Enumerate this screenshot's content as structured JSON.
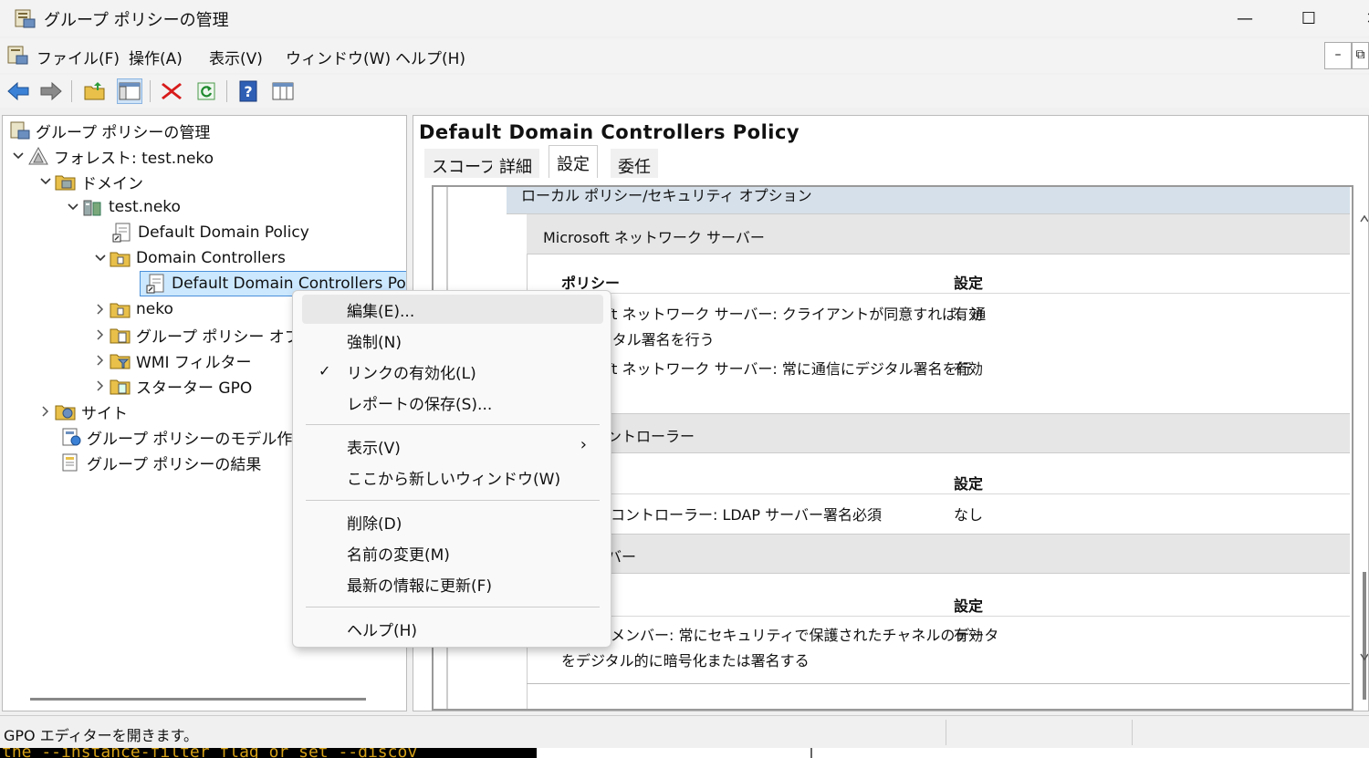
{
  "window": {
    "title": "グループ ポリシーの管理",
    "controls": {
      "minimize": "—",
      "maximize": "☐",
      "close": "✕"
    }
  },
  "menubar": {
    "items": [
      "ファイル(F)",
      "操作(A)",
      "表示(V)",
      "ウィンドウ(W)",
      "ヘルプ(H)"
    ],
    "mdi_min": "–",
    "mdi_restore": "⧉"
  },
  "toolbar": {
    "icons": [
      "back-arrow-icon",
      "forward-arrow-icon",
      "up-folder-icon",
      "show-hide-tree-icon",
      "delete-icon",
      "refresh-icon",
      "help-icon",
      "properties-icon"
    ]
  },
  "tree": {
    "root": "グループ ポリシーの管理",
    "forest": "フォレスト: test.neko",
    "domains": "ドメイン",
    "domain": "test.neko",
    "default_domain_policy": "Default Domain Policy",
    "domain_controllers": "Domain Controllers",
    "dc_policy": "Default Domain Controllers Pol",
    "neko": "neko",
    "gpo_objects": "グループ ポリシー オブジ",
    "wmi_filters": "WMI フィルター",
    "starter_gpo": "スターター GPO",
    "sites": "サイト",
    "modeling": "グループ ポリシーのモデル作成",
    "results": "グループ ポリシーの結果"
  },
  "right_pane": {
    "title": "Default Domain Controllers Policy",
    "tabs": [
      "スコープ",
      "詳細",
      "設定",
      "委任"
    ],
    "active_tab": "設定",
    "report": {
      "top_header": "ローカル ポリシー/セキュリティ オプション",
      "section1": {
        "title": "Microsoft ネットワーク サーバー",
        "col_policy": "ポリシー",
        "col_setting": "設定",
        "rows": [
          {
            "policy_l1": "oft ネットワーク サーバー: クライアントが同意すれば、通",
            "policy_l2": "ジタル署名を行う",
            "setting": "有効"
          },
          {
            "policy_l1": "oft ネットワーク サーバー: 常に通信にデジタル署名を行",
            "setting": "有効"
          }
        ]
      },
      "section2": {
        "title": "ントローラー",
        "col_setting": "設定",
        "rows": [
          {
            "policy": "コントローラー: LDAP サーバー署名必須",
            "setting": "なし"
          }
        ]
      },
      "section3": {
        "title": "バー",
        "col_setting": "設定",
        "rows": [
          {
            "policy_l1": "メンバー: 常にセキュリティで保護されたチャネルのデータ",
            "policy_l2": "をデジタル的に暗号化または署名する",
            "setting": "有効"
          }
        ]
      }
    }
  },
  "context_menu": {
    "items": [
      {
        "label": "編集(E)...",
        "highlighted": true
      },
      {
        "label": "強制(N)"
      },
      {
        "label": "リンクの有効化(L)",
        "checked": true
      },
      {
        "label": "レポートの保存(S)..."
      },
      {
        "label": "表示(V)",
        "submenu": true
      },
      {
        "label": "ここから新しいウィンドウ(W)"
      },
      {
        "label": "削除(D)"
      },
      {
        "label": "名前の変更(M)"
      },
      {
        "label": "最新の情報に更新(F)"
      },
      {
        "label": "ヘルプ(H)"
      }
    ],
    "check_glyph": "✓",
    "submenu_glyph": "›"
  },
  "statusbar": {
    "text": "GPO エディターを開きます。"
  },
  "console_text": "the --instance-filter flag or set --discov"
}
